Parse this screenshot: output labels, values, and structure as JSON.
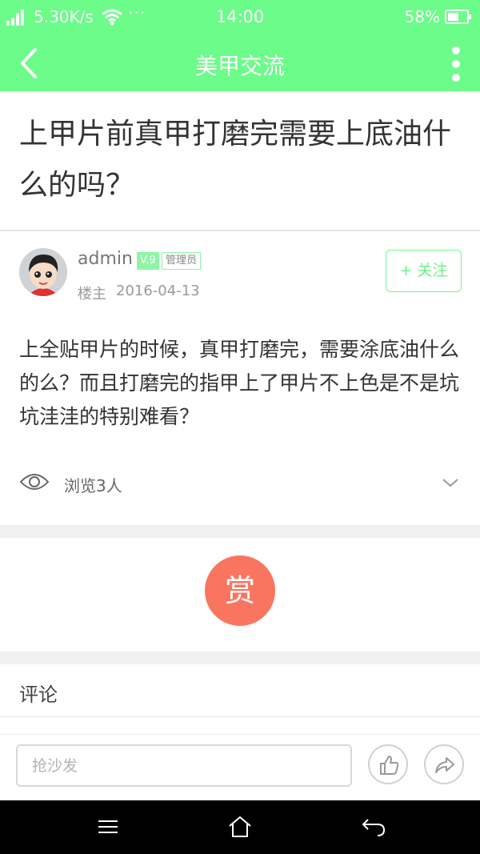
{
  "status_bar": {
    "network_speed": "5.30K/s",
    "more_dots": "···",
    "time": "14:00",
    "battery_percent": "58%",
    "battery_level": 0.58,
    "icons": [
      "signal-icon",
      "wifi-icon",
      "battery-icon"
    ]
  },
  "nav": {
    "title": "美甲交流",
    "back_icon": "back-arrow-icon",
    "more_icon": "more-vertical-icon"
  },
  "post": {
    "title": "上甲片前真甲打磨完需要上底油什么的吗？",
    "author": {
      "name": "admin",
      "level": "V.9",
      "role": "管理员",
      "floor_label": "楼主",
      "date": "2016-04-13"
    },
    "follow_label": "+ 关注",
    "body": "上全贴甲片的时候，真甲打磨完，需要涂底油什么的么？而且打磨完的指甲上了甲片不上色是不是坑坑洼洼的特别难看？",
    "views_label": "浏览3人"
  },
  "reward": {
    "label": "赏"
  },
  "comments": {
    "header": "评论"
  },
  "footer": {
    "reply_placeholder": "抢沙发",
    "like_icon": "thumbs-up-icon",
    "share_icon": "share-arrow-icon"
  },
  "system_nav": {
    "icons": [
      "menu-icon",
      "home-icon",
      "back-icon"
    ]
  },
  "colors": {
    "accent": "#6cfc8a",
    "reward": "#fa7560"
  }
}
